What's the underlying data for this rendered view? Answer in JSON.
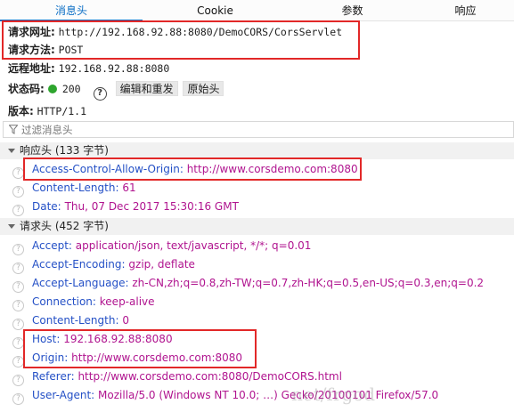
{
  "tabs": [
    {
      "label": "消息头"
    },
    {
      "label": "Cookie"
    },
    {
      "label": "参数"
    },
    {
      "label": "响应"
    }
  ],
  "summary": {
    "request_url_label": "请求网址:",
    "request_url": "http://192.168.92.88:8080/DemoCORS/CorsServlet",
    "request_method_label": "请求方法:",
    "request_method": "POST",
    "remote_address_label": "远程地址:",
    "remote_address": "192.168.92.88:8080",
    "status_label": "状态码:",
    "status_code": "200",
    "status_color": "#2ea52e",
    "edit_resend_label": "编辑和重发",
    "raw_headers_label": "原始头",
    "version_label": "版本:",
    "version": "HTTP/1.1"
  },
  "filter": {
    "placeholder": "过滤消息头"
  },
  "response_headers": {
    "title": "响应头 (133 字节)",
    "items": [
      {
        "name": "Access-Control-Allow-Origin:",
        "value": "http://www.corsdemo.com:8080"
      },
      {
        "name": "Content-Length:",
        "value": "61"
      },
      {
        "name": "Date:",
        "value": "Thu, 07 Dec 2017 15:30:16 GMT"
      }
    ]
  },
  "request_headers": {
    "title": "请求头 (452 字节)",
    "items": [
      {
        "name": "Accept:",
        "value": "application/json, text/javascript, */*; q=0.01"
      },
      {
        "name": "Accept-Encoding:",
        "value": "gzip, deflate"
      },
      {
        "name": "Accept-Language:",
        "value": "zh-CN,zh;q=0.8,zh-TW;q=0.7,zh-HK;q=0.5,en-US;q=0.3,en;q=0.2"
      },
      {
        "name": "Connection:",
        "value": "keep-alive"
      },
      {
        "name": "Content-Length:",
        "value": "0"
      },
      {
        "name": "Host:",
        "value": "192.168.92.88:8080"
      },
      {
        "name": "Origin:",
        "value": "http://www.corsdemo.com:8080"
      },
      {
        "name": "Referer:",
        "value": "http://www.corsdemo.com:8080/DemoCORS.html"
      },
      {
        "name": "User-Agent:",
        "value": "Mozilla/5.0 (Windows NT 10.0; …) Gecko/20100101 Firefox/57.0"
      }
    ]
  },
  "watermark": "net/frgod",
  "colors": {
    "accent": "#0b6ec5",
    "highlight_box": "#e22828",
    "header_name": "#2450c6",
    "header_value": "#b0148f"
  }
}
